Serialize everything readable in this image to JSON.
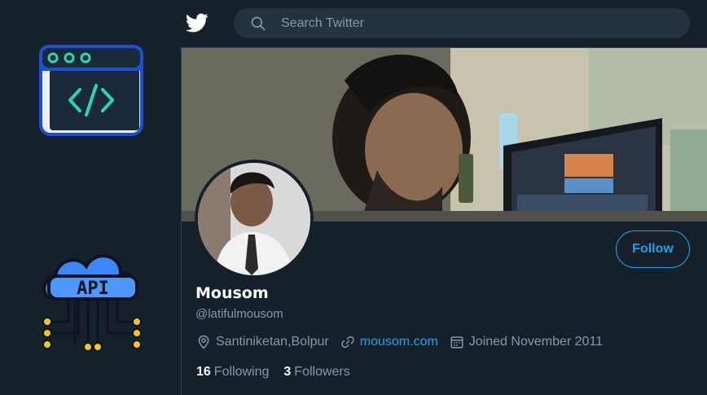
{
  "search": {
    "placeholder": "Search Twitter"
  },
  "left_logos": {
    "browser_logo": {
      "icon": "browser-code-icon",
      "colors": [
        "#1e5bd6",
        "#2bd7b0"
      ]
    },
    "api_logo": {
      "text": "API",
      "icon": "cloud-api-icon",
      "colors": [
        "#3d86f5",
        "#f5c518"
      ]
    }
  },
  "profile": {
    "display_name": "Mousom",
    "handle": "@latifulmousom",
    "location": "Santiniketan,Bolpur",
    "website": "mousom.com",
    "joined": "Joined November 2011",
    "following_count": "16",
    "following_label": "Following",
    "followers_count": "3",
    "followers_label": "Followers",
    "follow_button": "Follow"
  },
  "colors": {
    "background": "#15202b",
    "accent": "#1da1f2",
    "muted_text": "#8899a6",
    "search_bg": "#253341"
  }
}
